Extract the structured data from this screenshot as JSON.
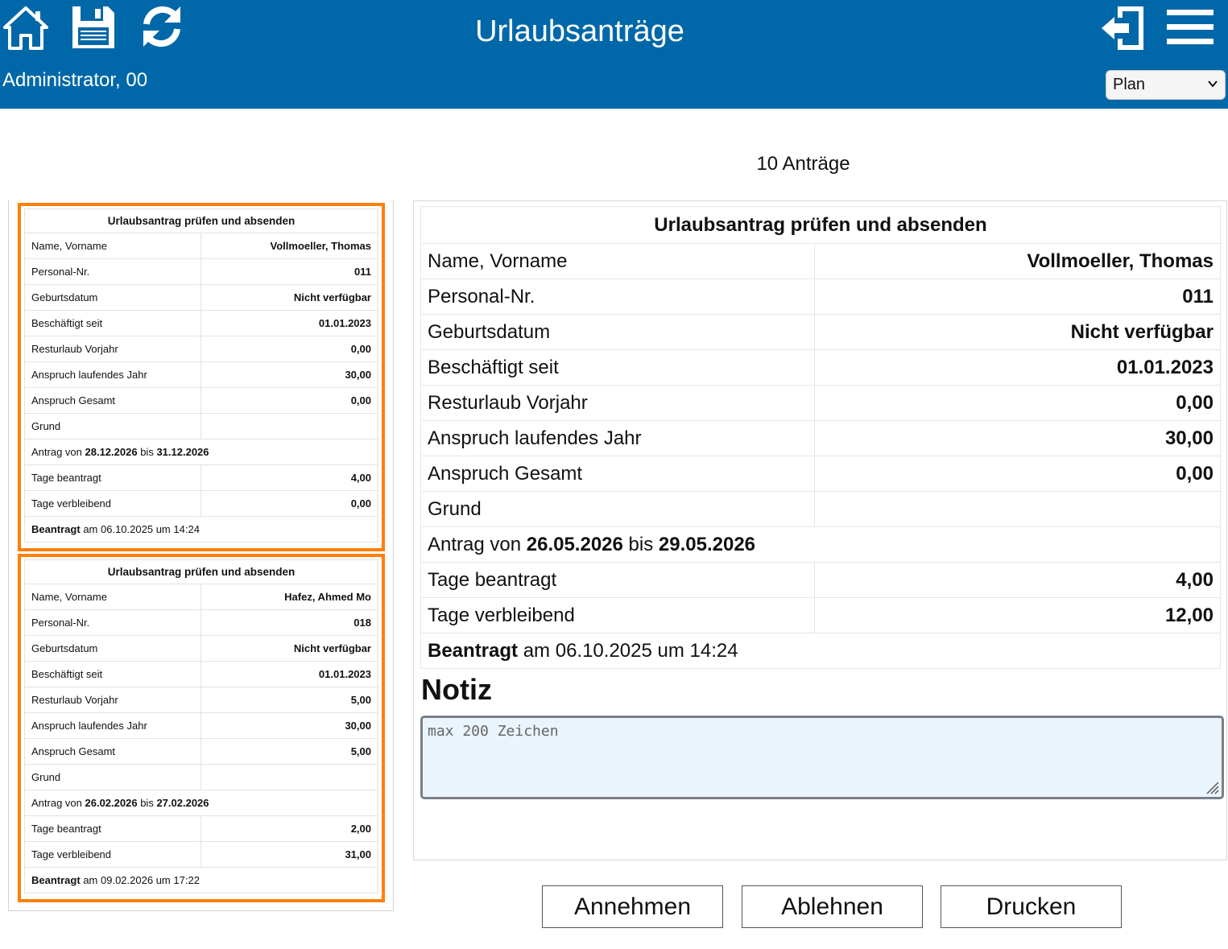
{
  "header": {
    "title": "Urlaubsanträge",
    "user": "Administrator, 00",
    "plan_select": "Plan",
    "icons": [
      "home-icon",
      "save-icon",
      "refresh-icon",
      "logout-icon",
      "menu-icon"
    ],
    "bg_color": "#0068a8"
  },
  "count_label": "10 Anträge",
  "labels": {
    "card_title": "Urlaubsantrag prüfen und absenden",
    "name": "Name, Vorname",
    "pers": "Personal-Nr.",
    "birth": "Geburtsdatum",
    "employed": "Beschäftigt seit",
    "rest": "Resturlaub Vorjahr",
    "claim_year": "Anspruch laufendes Jahr",
    "claim_total": "Anspruch Gesamt",
    "reason": "Grund",
    "request_from": "Antrag von",
    "to": "bis",
    "days_requested": "Tage beantragt",
    "days_remaining": "Tage verbleibend",
    "applied": "Beantragt",
    "applied_on": "am",
    "at": "um"
  },
  "requests": [
    {
      "name": "Vollmoeller, Thomas",
      "pers": "011",
      "birth": "Nicht verfügbar",
      "employed": "01.01.2023",
      "rest": "0,00",
      "claim_year": "30,00",
      "claim_total": "0,00",
      "reason": "",
      "from": "28.12.2026",
      "to": "31.12.2026",
      "days_requested": "4,00",
      "days_remaining": "0,00",
      "applied_date": "06.10.2025",
      "applied_time": "14:24"
    },
    {
      "name": "Hafez, Ahmed Mo",
      "pers": "018",
      "birth": "Nicht verfügbar",
      "employed": "01.01.2023",
      "rest": "5,00",
      "claim_year": "30,00",
      "claim_total": "5,00",
      "reason": "",
      "from": "26.02.2026",
      "to": "27.02.2026",
      "days_requested": "2,00",
      "days_remaining": "31,00",
      "applied_date": "09.02.2026",
      "applied_time": "17:22"
    }
  ],
  "detail": {
    "name": "Vollmoeller, Thomas",
    "pers": "011",
    "birth": "Nicht verfügbar",
    "employed": "01.01.2023",
    "rest": "0,00",
    "claim_year": "30,00",
    "claim_total": "0,00",
    "reason": "",
    "from": "26.05.2026",
    "to": "29.05.2026",
    "days_requested": "4,00",
    "days_remaining": "12,00",
    "applied_date": "06.10.2025",
    "applied_time": "14:24"
  },
  "note": {
    "label": "Notiz",
    "placeholder": "max 200 Zeichen"
  },
  "buttons": {
    "accept": "Annehmen",
    "reject": "Ablehnen",
    "print": "Drucken"
  },
  "accent_color": "#ff7f0a"
}
